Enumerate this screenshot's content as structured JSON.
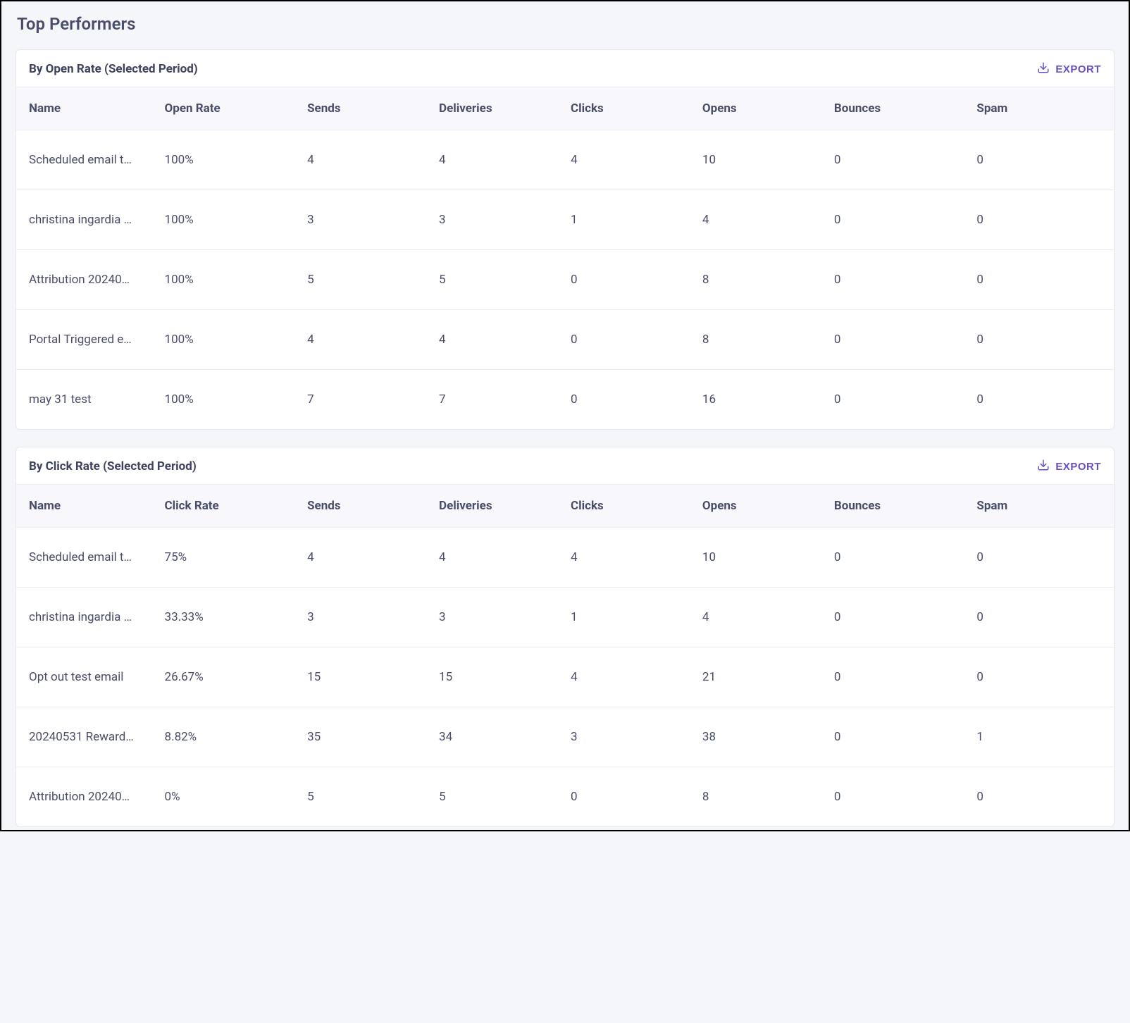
{
  "page_title": "Top Performers",
  "export_label": "EXPORT",
  "tables": [
    {
      "title": "By Open Rate (Selected Period)",
      "rate_header": "Open Rate",
      "headers": {
        "name": "Name",
        "sends": "Sends",
        "deliveries": "Deliveries",
        "clicks": "Clicks",
        "opens": "Opens",
        "bounces": "Bounces",
        "spam": "Spam"
      },
      "rows": [
        {
          "name": "Scheduled email t…",
          "rate": "100%",
          "sends": "4",
          "deliveries": "4",
          "clicks": "4",
          "opens": "10",
          "bounces": "0",
          "spam": "0"
        },
        {
          "name": "christina ingardia …",
          "rate": "100%",
          "sends": "3",
          "deliveries": "3",
          "clicks": "1",
          "opens": "4",
          "bounces": "0",
          "spam": "0"
        },
        {
          "name": "Attribution 20240…",
          "rate": "100%",
          "sends": "5",
          "deliveries": "5",
          "clicks": "0",
          "opens": "8",
          "bounces": "0",
          "spam": "0"
        },
        {
          "name": "Portal Triggered e…",
          "rate": "100%",
          "sends": "4",
          "deliveries": "4",
          "clicks": "0",
          "opens": "8",
          "bounces": "0",
          "spam": "0"
        },
        {
          "name": "may 31 test",
          "rate": "100%",
          "sends": "7",
          "deliveries": "7",
          "clicks": "0",
          "opens": "16",
          "bounces": "0",
          "spam": "0"
        }
      ]
    },
    {
      "title": "By Click Rate (Selected Period)",
      "rate_header": "Click Rate",
      "headers": {
        "name": "Name",
        "sends": "Sends",
        "deliveries": "Deliveries",
        "clicks": "Clicks",
        "opens": "Opens",
        "bounces": "Bounces",
        "spam": "Spam"
      },
      "rows": [
        {
          "name": "Scheduled email t…",
          "rate": "75%",
          "sends": "4",
          "deliveries": "4",
          "clicks": "4",
          "opens": "10",
          "bounces": "0",
          "spam": "0"
        },
        {
          "name": "christina ingardia …",
          "rate": "33.33%",
          "sends": "3",
          "deliveries": "3",
          "clicks": "1",
          "opens": "4",
          "bounces": "0",
          "spam": "0"
        },
        {
          "name": "Opt out test email",
          "rate": "26.67%",
          "sends": "15",
          "deliveries": "15",
          "clicks": "4",
          "opens": "21",
          "bounces": "0",
          "spam": "0"
        },
        {
          "name": "20240531 Reward…",
          "rate": "8.82%",
          "sends": "35",
          "deliveries": "34",
          "clicks": "3",
          "opens": "38",
          "bounces": "0",
          "spam": "1"
        },
        {
          "name": "Attribution 20240…",
          "rate": "0%",
          "sends": "5",
          "deliveries": "5",
          "clicks": "0",
          "opens": "8",
          "bounces": "0",
          "spam": "0"
        }
      ]
    }
  ]
}
